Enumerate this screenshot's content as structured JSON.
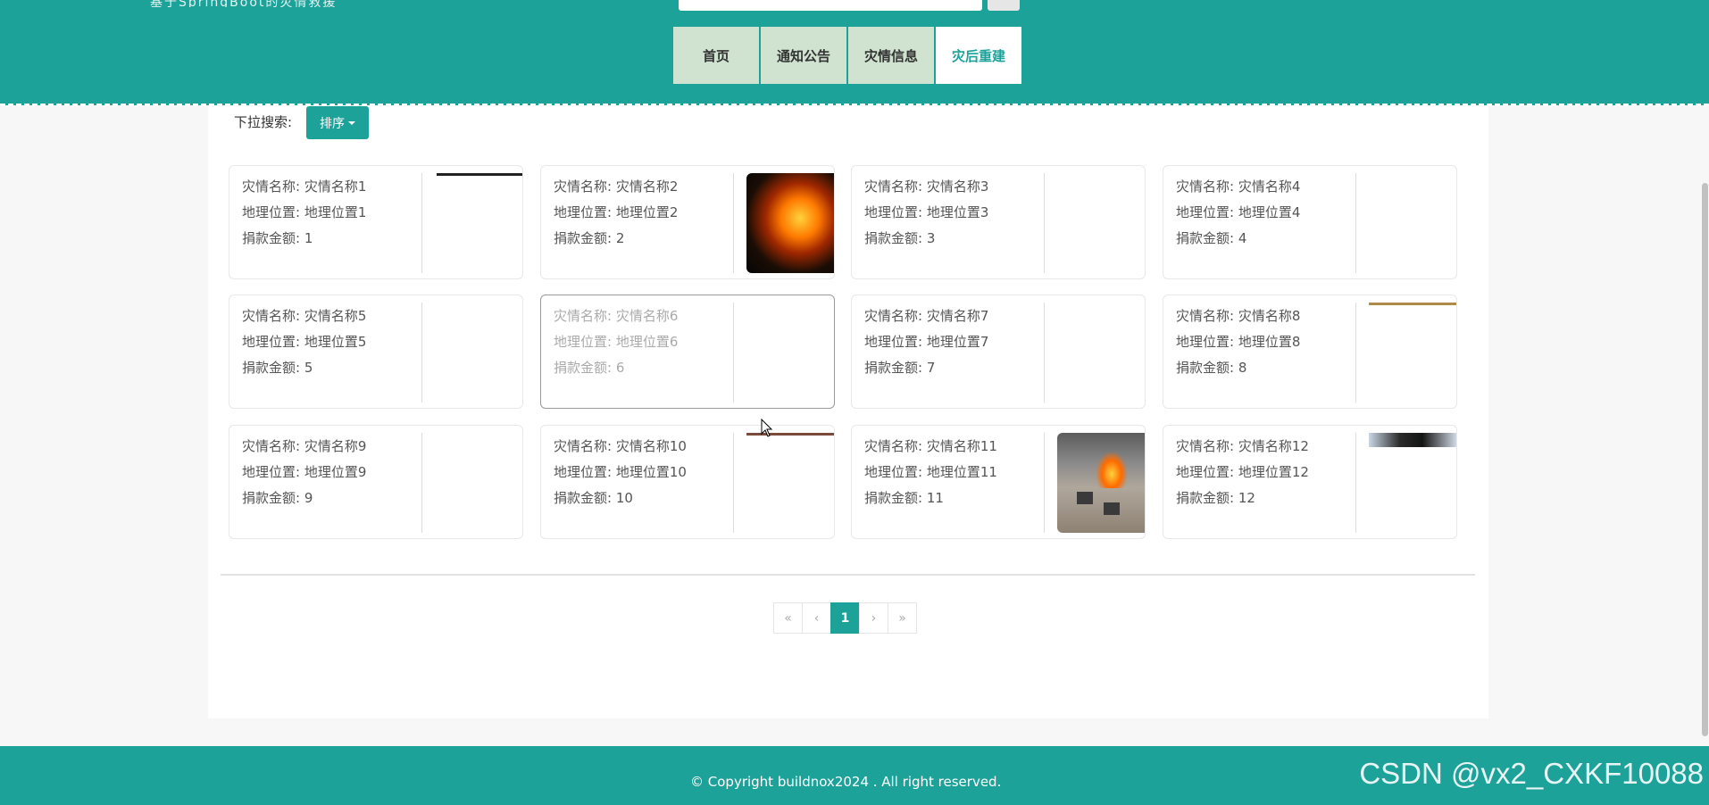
{
  "header": {
    "title": "基于SpringBoot的灾情救援",
    "nav": [
      {
        "label": "首页"
      },
      {
        "label": "通知公告"
      },
      {
        "label": "灾情信息"
      },
      {
        "label": "灾后重建",
        "active": true
      }
    ]
  },
  "search": {
    "label": "下拉搜索:",
    "sort_label": "排序"
  },
  "cards": [
    {
      "name_label": "灾情名称: 灾情名称1",
      "location_label": "地理位置: 地理位置1",
      "amount_label": "捐款金额: 1"
    },
    {
      "name_label": "灾情名称: 灾情名称2",
      "location_label": "地理位置: 地理位置2",
      "amount_label": "捐款金额: 2"
    },
    {
      "name_label": "灾情名称: 灾情名称3",
      "location_label": "地理位置: 地理位置3",
      "amount_label": "捐款金额: 3"
    },
    {
      "name_label": "灾情名称: 灾情名称4",
      "location_label": "地理位置: 地理位置4",
      "amount_label": "捐款金额: 4"
    },
    {
      "name_label": "灾情名称: 灾情名称5",
      "location_label": "地理位置: 地理位置5",
      "amount_label": "捐款金额: 5"
    },
    {
      "name_label": "灾情名称: 灾情名称6",
      "location_label": "地理位置: 地理位置6",
      "amount_label": "捐款金额: 6"
    },
    {
      "name_label": "灾情名称: 灾情名称7",
      "location_label": "地理位置: 地理位置7",
      "amount_label": "捐款金额: 7"
    },
    {
      "name_label": "灾情名称: 灾情名称8",
      "location_label": "地理位置: 地理位置8",
      "amount_label": "捐款金额: 8"
    },
    {
      "name_label": "灾情名称: 灾情名称9",
      "location_label": "地理位置: 地理位置9",
      "amount_label": "捐款金额: 9"
    },
    {
      "name_label": "灾情名称: 灾情名称10",
      "location_label": "地理位置: 地理位置10",
      "amount_label": "捐款金额: 10"
    },
    {
      "name_label": "灾情名称: 灾情名称11",
      "location_label": "地理位置: 地理位置11",
      "amount_label": "捐款金额: 11"
    },
    {
      "name_label": "灾情名称: 灾情名称12",
      "location_label": "地理位置: 地理位置12",
      "amount_label": "捐款金额: 12"
    }
  ],
  "pagination": {
    "first": "«",
    "prev": "‹",
    "current": "1",
    "next": "›",
    "last": "»"
  },
  "footer": {
    "copyright": "© Copyright buildnox2024 . All right reserved.",
    "watermark": "CSDN @vx2_CXKF10088"
  },
  "colors": {
    "primary": "#1da29a",
    "nav_bg": "#cfe3d0"
  }
}
